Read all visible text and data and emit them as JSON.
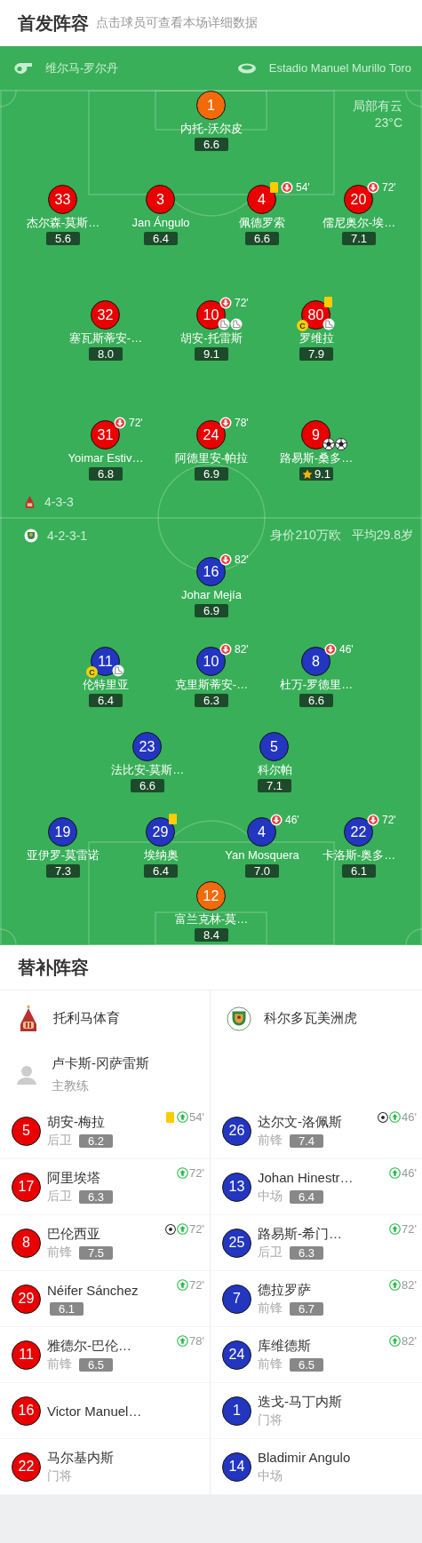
{
  "header": {
    "title": "首发阵容",
    "subtitle": "点击球员可查看本场详细数据"
  },
  "match": {
    "referee": "维尔马-罗尔丹",
    "stadium": "Estadio Manuel Murillo Toro",
    "weather": "局部有云",
    "temperature": "23°C"
  },
  "home": {
    "formation": "4-3-3",
    "lines": [
      [
        {
          "number": "1",
          "name": "内托-沃尔皮",
          "rating": "6.6",
          "color": "#f26a0a",
          "yellow_card": false,
          "captain": false,
          "best": false
        }
      ],
      [
        {
          "number": "33",
          "name": "杰尔森-莫斯…",
          "rating": "5.6",
          "color": "#e90000",
          "yellow_card": false,
          "captain": false,
          "best": false
        },
        {
          "number": "3",
          "name": "Jan Ángulo",
          "rating": "6.4",
          "color": "#e90000",
          "yellow_card": false,
          "captain": false,
          "best": false
        },
        {
          "number": "4",
          "name": "佩德罗索",
          "rating": "6.6",
          "color": "#e90000",
          "yellow_card": true,
          "sub_off": "54'",
          "captain": false,
          "best": false
        },
        {
          "number": "20",
          "name": "儒尼奥尔-埃…",
          "rating": "7.1",
          "color": "#e90000",
          "yellow_card": false,
          "sub_off": "72'",
          "captain": false,
          "best": false
        }
      ],
      [
        {
          "number": "32",
          "name": "塞瓦斯蒂安-…",
          "rating": "8.0",
          "color": "#e90000",
          "yellow_card": false,
          "captain": false,
          "best": false
        },
        {
          "number": "10",
          "name": "胡安-托雷斯",
          "rating": "9.1",
          "color": "#e90000",
          "yellow_card": false,
          "sub_off": "72'",
          "captain": false,
          "best": false,
          "icons": [
            {
              "kind": "assist"
            },
            {
              "kind": "assist"
            }
          ]
        },
        {
          "number": "80",
          "name": "罗维拉",
          "rating": "7.9",
          "color": "#e90000",
          "yellow_card": true,
          "captain": true,
          "captain_badge": "C",
          "best": false,
          "icons": [
            {
              "kind": "assist"
            }
          ]
        }
      ],
      [
        {
          "number": "31",
          "name": "Yoimar Estiv…",
          "rating": "6.8",
          "color": "#e90000",
          "yellow_card": false,
          "sub_off": "72'",
          "captain": false,
          "best": false
        },
        {
          "number": "24",
          "name": "阿德里安-帕拉",
          "rating": "6.9",
          "color": "#e90000",
          "yellow_card": false,
          "sub_off": "78'",
          "captain": false,
          "best": false
        },
        {
          "number": "9",
          "name": "路易斯-桑多…",
          "rating": "9.1",
          "color": "#e90000",
          "yellow_card": false,
          "captain": false,
          "best": true,
          "icons": [
            {
              "kind": "goal"
            },
            {
              "kind": "goal"
            }
          ]
        }
      ]
    ]
  },
  "away": {
    "formation": "4-2-3-1",
    "market_value": "身价210万欧",
    "average_age": "平均29.8岁",
    "lines": [
      [
        {
          "number": "16",
          "name": "Johar Mejía",
          "rating": "6.9",
          "color": "#2336c0",
          "yellow_card": false,
          "sub_off": "82'",
          "captain": false,
          "best": false
        }
      ],
      [
        {
          "number": "11",
          "name": "伦特里亚",
          "rating": "6.4",
          "color": "#2336c0",
          "yellow_card": false,
          "captain": true,
          "captain_badge": "C",
          "best": false,
          "icons": [
            {
              "kind": "assist"
            }
          ]
        },
        {
          "number": "10",
          "name": "克里斯蒂安-…",
          "rating": "6.3",
          "color": "#2336c0",
          "yellow_card": false,
          "sub_off": "82'",
          "captain": false,
          "best": false
        },
        {
          "number": "8",
          "name": "杜万-罗德里…",
          "rating": "6.6",
          "color": "#2336c0",
          "yellow_card": false,
          "sub_off": "46'",
          "captain": false,
          "best": false
        }
      ],
      [
        {
          "number": "23",
          "name": "法比安-莫斯…",
          "rating": "6.6",
          "color": "#2336c0",
          "yellow_card": false,
          "captain": false,
          "best": false
        },
        {
          "number": "5",
          "name": "科尔帕",
          "rating": "7.1",
          "color": "#2336c0",
          "yellow_card": false,
          "captain": false,
          "best": false
        }
      ],
      [
        {
          "number": "19",
          "name": "亚伊罗-莫雷诺",
          "rating": "7.3",
          "color": "#2336c0",
          "yellow_card": false,
          "captain": false,
          "best": false
        },
        {
          "number": "29",
          "name": "埃纳奥",
          "rating": "6.4",
          "color": "#2336c0",
          "yellow_card": true,
          "captain": false,
          "best": false
        },
        {
          "number": "4",
          "name": "Yan Mosquera",
          "rating": "7.0",
          "color": "#2336c0",
          "yellow_card": false,
          "sub_off": "46'",
          "captain": false,
          "best": false
        },
        {
          "number": "22",
          "name": "卡洛斯-奥多…",
          "rating": "6.1",
          "color": "#2336c0",
          "yellow_card": false,
          "sub_off": "72'",
          "captain": false,
          "best": false
        }
      ],
      [
        {
          "number": "12",
          "name": "富兰克林-莫…",
          "rating": "8.4",
          "color": "#f26a0a",
          "yellow_card": false,
          "captain": false,
          "best": false
        }
      ]
    ]
  },
  "subs": {
    "title": "替补阵容",
    "sides": [
      {
        "team": "托利马体育",
        "coach": "卢卡斯-冈萨雷斯",
        "coach_role": "主教练",
        "color": "#e90000",
        "players": [
          {
            "number": "5",
            "name": "胡安-梅拉",
            "position": "后卫",
            "rating": "6.2",
            "yellow_card": true,
            "goal": false,
            "sub_on": "54'"
          },
          {
            "number": "17",
            "name": "阿里埃塔",
            "position": "后卫",
            "rating": "6.3",
            "yellow_card": false,
            "goal": false,
            "sub_on": "72'"
          },
          {
            "number": "8",
            "name": "巴伦西亚",
            "position": "前锋",
            "rating": "7.5",
            "yellow_card": false,
            "goal": true,
            "sub_on": "72'"
          },
          {
            "number": "29",
            "name": "Néifer Sánchez",
            "rating": "6.1",
            "yellow_card": false,
            "goal": false,
            "sub_on": "72'"
          },
          {
            "number": "11",
            "name": "雅德尔-巴伦…",
            "position": "前锋",
            "rating": "6.5",
            "yellow_card": false,
            "goal": false,
            "sub_on": "78'"
          },
          {
            "number": "16",
            "name": "Victor Manuel…",
            "yellow_card": false,
            "goal": false
          },
          {
            "number": "22",
            "name": "马尔基内斯",
            "position": "门将",
            "yellow_card": false,
            "goal": false
          }
        ]
      },
      {
        "team": "科尔多瓦美洲虎",
        "color": "#2336c0",
        "players": [
          {
            "number": "26",
            "name": "达尔文-洛佩斯",
            "position": "前锋",
            "rating": "7.4",
            "yellow_card": false,
            "goal": true,
            "sub_on": "46'"
          },
          {
            "number": "13",
            "name": "Johan Hinestr…",
            "position": "中场",
            "rating": "6.4",
            "yellow_card": false,
            "goal": false,
            "sub_on": "46'"
          },
          {
            "number": "25",
            "name": "路易斯-希门…",
            "position": "后卫",
            "rating": "6.3",
            "yellow_card": false,
            "goal": false,
            "sub_on": "72'"
          },
          {
            "number": "7",
            "name": "德拉罗萨",
            "position": "前锋",
            "rating": "6.7",
            "yellow_card": false,
            "goal": false,
            "sub_on": "82'"
          },
          {
            "number": "24",
            "name": "库维德斯",
            "position": "前锋",
            "rating": "6.5",
            "yellow_card": false,
            "goal": false,
            "sub_on": "82'"
          },
          {
            "number": "1",
            "name": "迭戈-马丁内斯",
            "position": "门将",
            "yellow_card": false,
            "goal": false
          },
          {
            "number": "14",
            "name": "Bladimir Angulo",
            "position": "中场",
            "yellow_card": false,
            "goal": false
          }
        ]
      }
    ]
  }
}
